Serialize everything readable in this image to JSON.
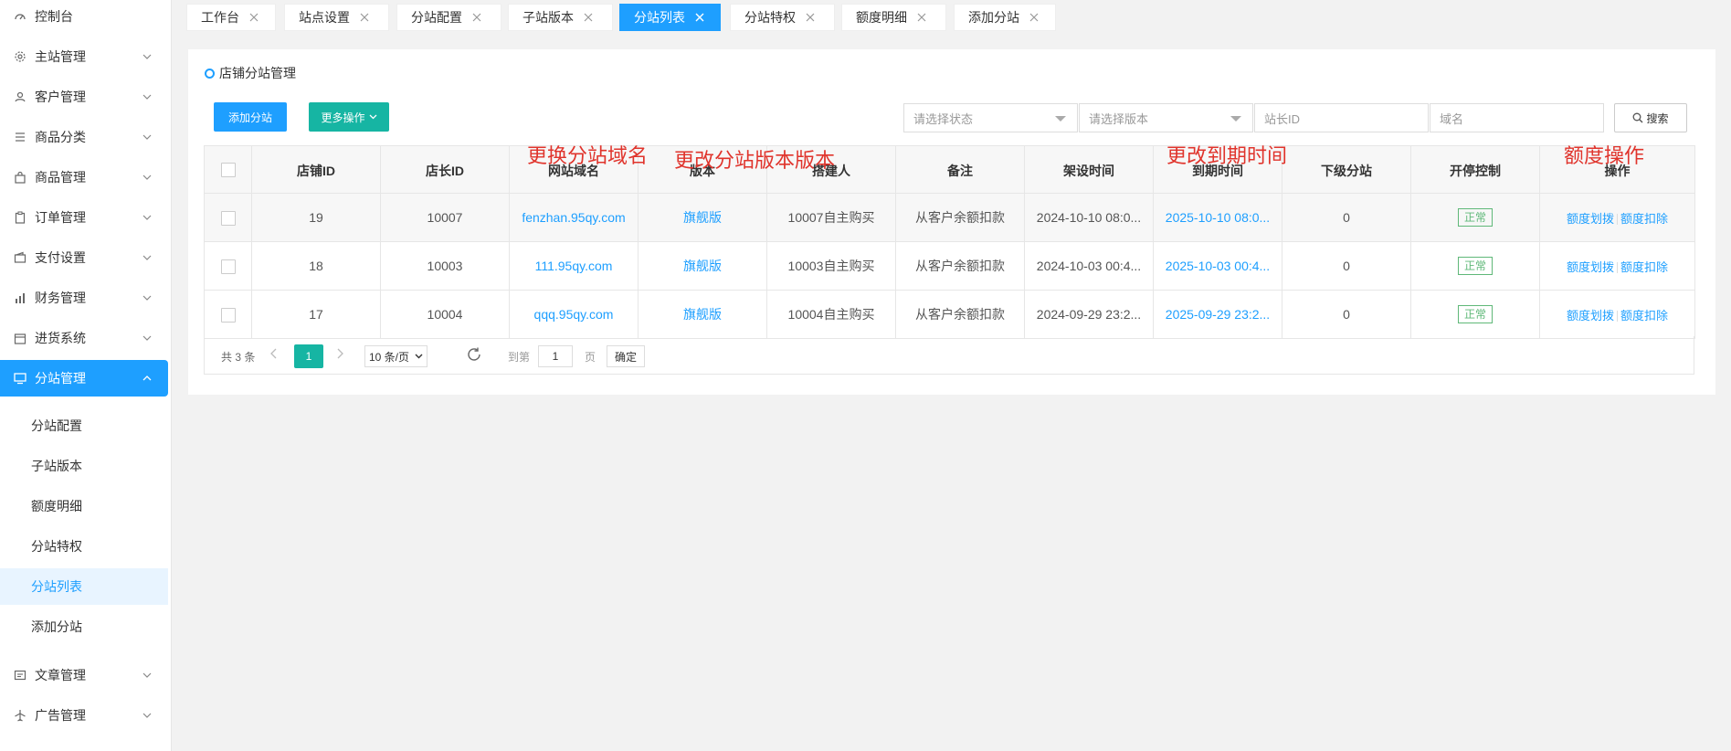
{
  "sidebar": {
    "top_item": {
      "label": "控制台",
      "icon": "dashboard-icon"
    },
    "items": [
      {
        "label": "主站管理",
        "icon": "gear-icon"
      },
      {
        "label": "客户管理",
        "icon": "user-icon"
      },
      {
        "label": "商品分类",
        "icon": "list-icon"
      },
      {
        "label": "商品管理",
        "icon": "bag-icon"
      },
      {
        "label": "订单管理",
        "icon": "clipboard-icon"
      },
      {
        "label": "支付设置",
        "icon": "wallet-icon"
      },
      {
        "label": "财务管理",
        "icon": "bar-chart-icon"
      },
      {
        "label": "进货系统",
        "icon": "calendar-icon"
      },
      {
        "label": "分站管理",
        "icon": "monitor-icon"
      }
    ],
    "sub_items": [
      "分站配置",
      "子站版本",
      "额度明细",
      "分站特权",
      "分站列表",
      "添加分站"
    ],
    "bottom_items": [
      {
        "label": "文章管理",
        "icon": "article-icon"
      },
      {
        "label": "广告管理",
        "icon": "plane-icon"
      }
    ]
  },
  "tabs": [
    "工作台",
    "站点设置",
    "分站配置",
    "子站版本",
    "分站列表",
    "分站特权",
    "额度明细",
    "添加分站"
  ],
  "panel": {
    "title": "店铺分站管理",
    "add_button": "添加分站",
    "more_button": "更多操作",
    "filters": {
      "status_placeholder": "请选择状态",
      "version_placeholder": "请选择版本",
      "owner_id_placeholder": "站长ID",
      "domain_placeholder": "域名",
      "search_button": "搜索"
    }
  },
  "table": {
    "headers": [
      "店铺ID",
      "店长ID",
      "网站域名",
      "版本",
      "搭建人",
      "备注",
      "架设时间",
      "到期时间",
      "下级分站",
      "开停控制",
      "操作"
    ],
    "rows": [
      {
        "shop_id": "19",
        "owner_id": "10007",
        "domain": "fenzhan.95qy.com",
        "version": "旗舰版",
        "builder": "10007自主购买",
        "remark": "从客户余额扣款",
        "created": "2024-10-10 08:0...",
        "expires": "2025-10-10 08:0...",
        "children": "0",
        "status": "正常",
        "op1": "额度划拨",
        "op2": "额度扣除"
      },
      {
        "shop_id": "18",
        "owner_id": "10003",
        "domain": "111.95qy.com",
        "version": "旗舰版",
        "builder": "10003自主购买",
        "remark": "从客户余额扣款",
        "created": "2024-10-03 00:4...",
        "expires": "2025-10-03 00:4...",
        "children": "0",
        "status": "正常",
        "op1": "额度划拨",
        "op2": "额度扣除"
      },
      {
        "shop_id": "17",
        "owner_id": "10004",
        "domain": "qqq.95qy.com",
        "version": "旗舰版",
        "builder": "10004自主购买",
        "remark": "从客户余额扣款",
        "created": "2024-09-29 23:2...",
        "expires": "2025-09-29 23:2...",
        "children": "0",
        "status": "正常",
        "op1": "额度划拨",
        "op2": "额度扣除"
      }
    ]
  },
  "annotations": {
    "domain": "更换分站域名",
    "version": "更改分站版本版本",
    "expire": "更改到期时间",
    "quota": "额度操作"
  },
  "pager": {
    "total": "共 3 条",
    "current_page": "1",
    "page_size": "10 条/页",
    "goto_label": "到第",
    "goto_value": "1",
    "page_unit": "页",
    "confirm": "确定"
  },
  "colors": {
    "primary": "#1e9fff",
    "teal": "#16b5a3",
    "status_green": "#5fb878",
    "annotation_red": "#e0342c"
  }
}
